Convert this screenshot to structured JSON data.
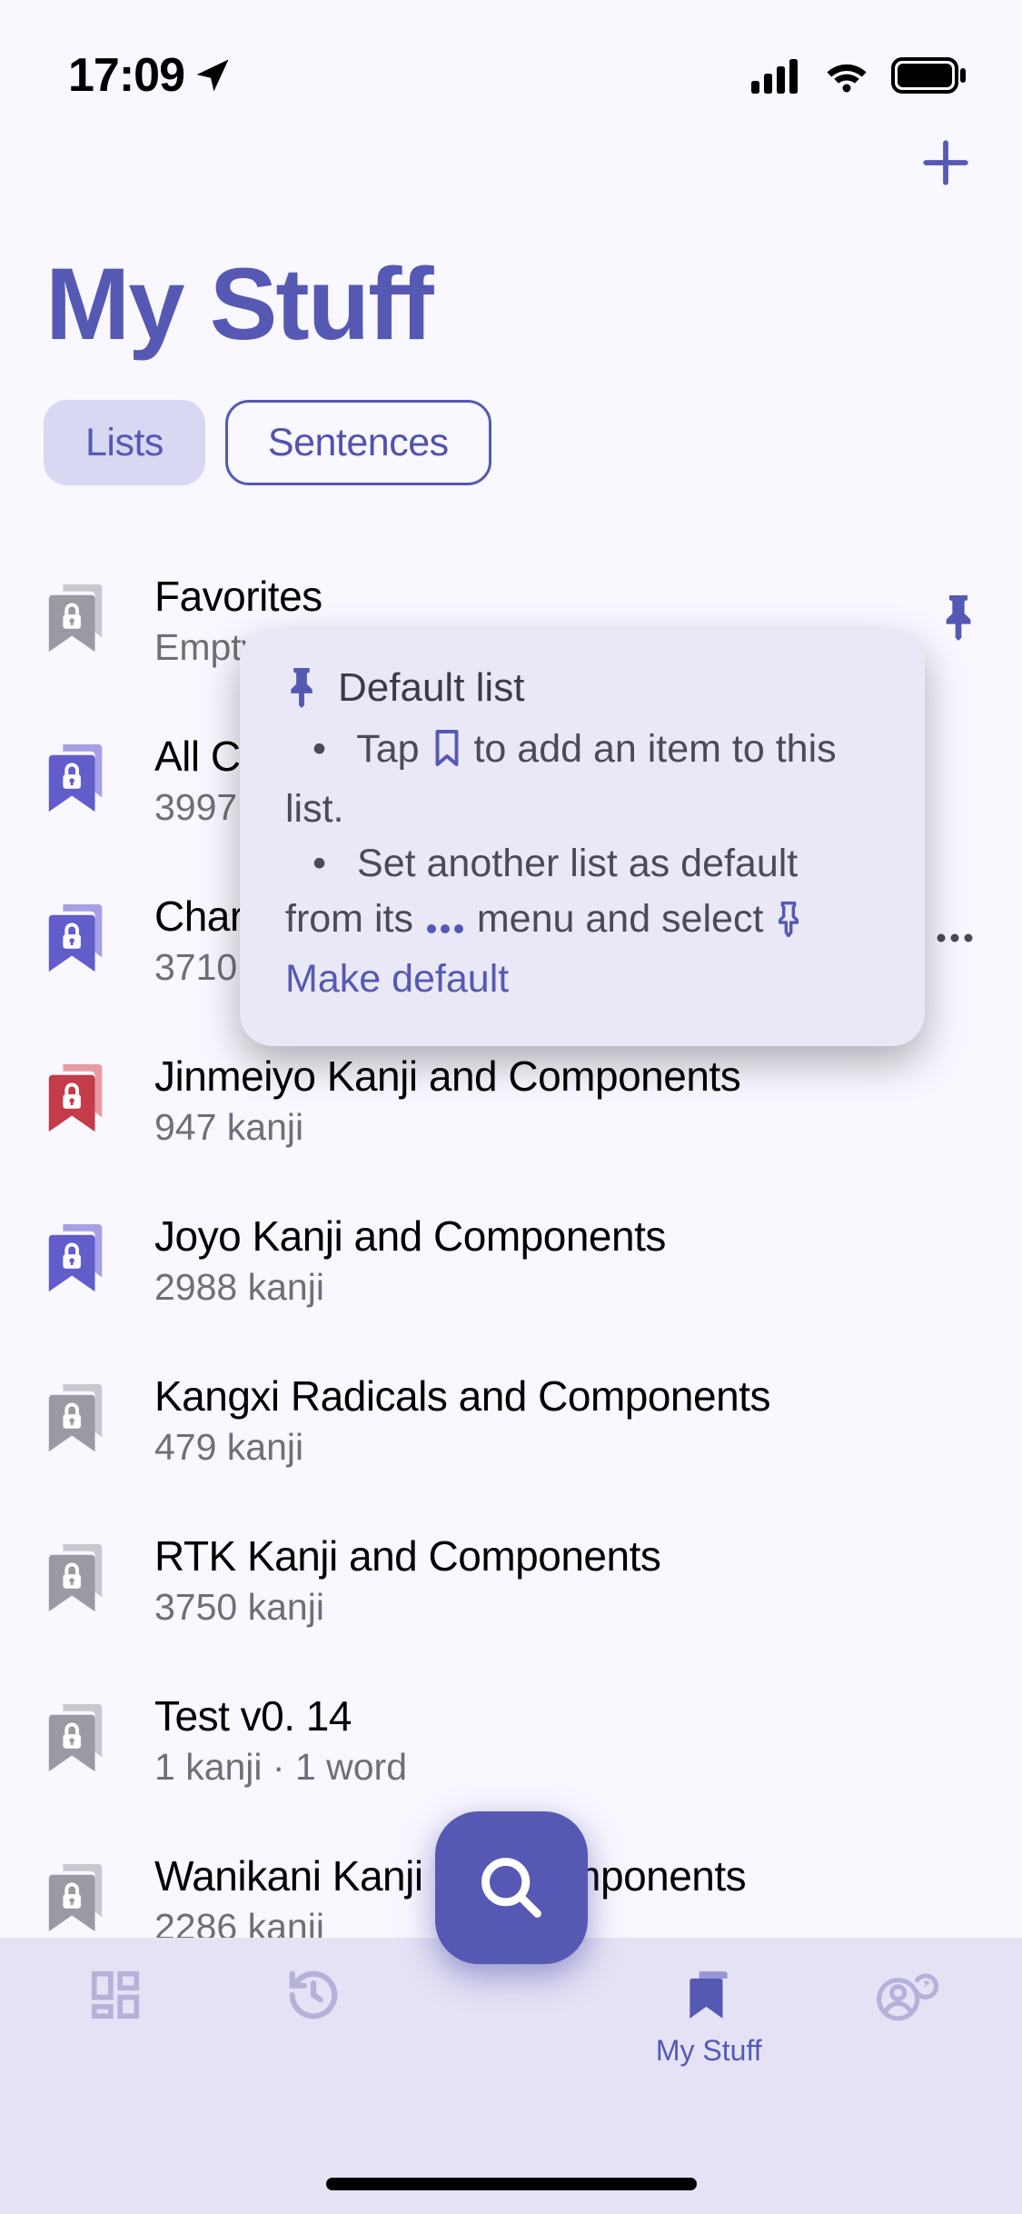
{
  "status": {
    "time": "17:09"
  },
  "nav": {
    "plus_name": "plus"
  },
  "header": {
    "title": "My Stuff"
  },
  "segmented": {
    "lists": "Lists",
    "sentences": "Sentences"
  },
  "lists": [
    {
      "title": "Favorites",
      "subtitle": "Empty list",
      "icon_color": "gray",
      "more": false,
      "pinned": true
    },
    {
      "title": "All Components and Kanji",
      "subtitle": "3997 kanji",
      "icon_color": "purple",
      "more": false,
      "pinned": false
    },
    {
      "title": "Characters in Textbooks",
      "subtitle": "3710 kanji",
      "icon_color": "purple",
      "more": true,
      "pinned": false
    },
    {
      "title": "Jinmeiyo Kanji and Components",
      "subtitle": "947 kanji",
      "icon_color": "red",
      "more": false,
      "pinned": false
    },
    {
      "title": "Joyo Kanji and Components",
      "subtitle": "2988 kanji",
      "icon_color": "purple",
      "more": false,
      "pinned": false
    },
    {
      "title": "Kangxi Radicals and Components",
      "subtitle": "479 kanji",
      "icon_color": "gray",
      "more": false,
      "pinned": false
    },
    {
      "title": "RTK Kanji and Components",
      "subtitle": "3750 kanji",
      "icon_color": "gray",
      "more": false,
      "pinned": false
    },
    {
      "title": "Test v0. 14",
      "subtitle": "1 kanji · 1 word",
      "icon_color": "gray",
      "more": false,
      "pinned": false
    },
    {
      "title": "Wanikani Kanji and Components",
      "subtitle": "2286 kanji",
      "icon_color": "gray",
      "more": false,
      "pinned": false
    }
  ],
  "popover": {
    "title": "Default list",
    "hint1_pre": "Tap ",
    "hint1_post": " to add an item to this list.",
    "hint2_pre": "Set another list as default from its ",
    "hint2_mid": " menu and select ",
    "make_default": "Make default"
  },
  "tabs": {
    "my_stuff": "My Stuff"
  },
  "icon_colors": {
    "gray": {
      "front": "#9A9AA3",
      "back": "#C8C8CF"
    },
    "purple": {
      "front": "#625DCB",
      "back": "#A5A0E3"
    },
    "red": {
      "front": "#C43B49",
      "back": "#E79BA2"
    }
  }
}
